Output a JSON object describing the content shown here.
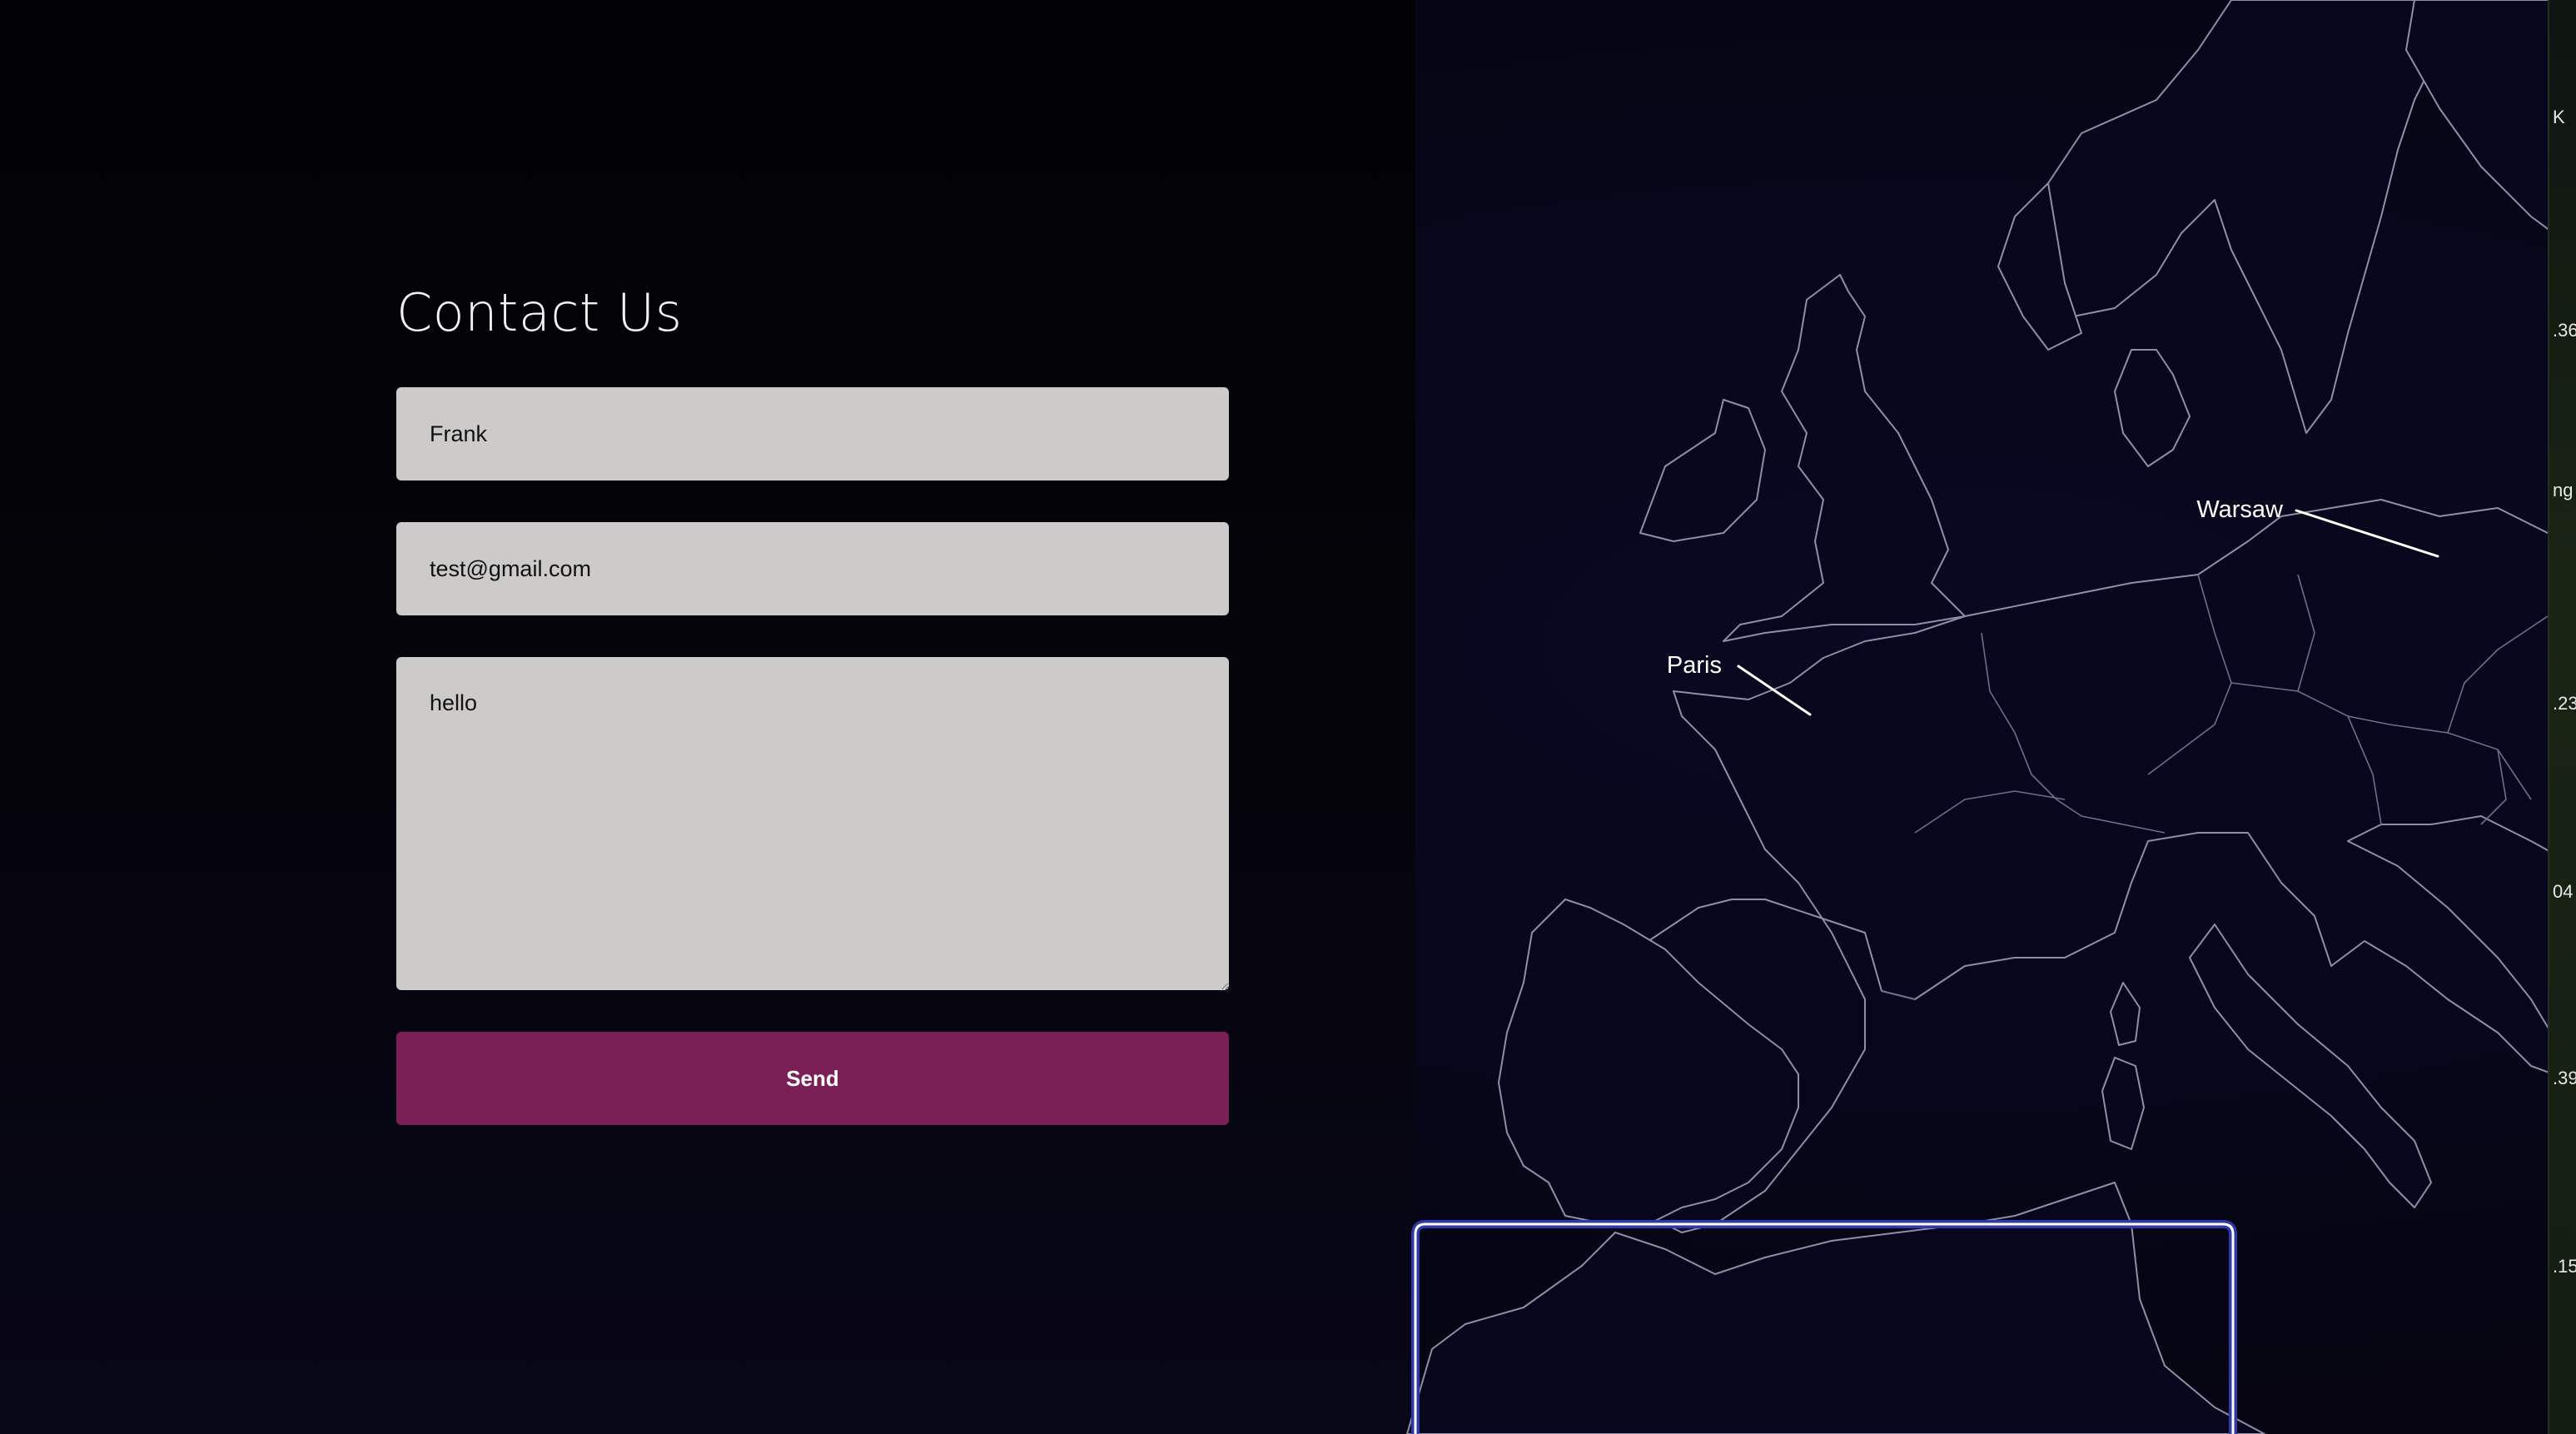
{
  "contact": {
    "title": "Contact Us",
    "name_value": "Frank",
    "email_value": "test@gmail.com",
    "message_value": "hello",
    "send_label": "Send"
  },
  "map": {
    "cities": [
      {
        "name": "Paris"
      },
      {
        "name": "Warsaw"
      }
    ]
  },
  "side_panel": {
    "labels": [
      "K",
      ".36",
      "ng",
      ".23",
      "04",
      ".39",
      ".15"
    ]
  },
  "colors": {
    "send_button": "#7a2056",
    "field_bg": "#cccbca",
    "highlight_border": "#2f3aa8"
  }
}
